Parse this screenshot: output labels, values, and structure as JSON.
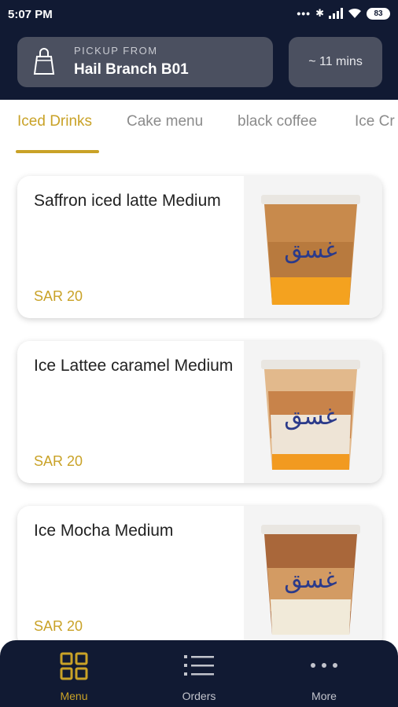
{
  "status_bar": {
    "time": "5:07 PM",
    "battery": "83"
  },
  "pickup": {
    "label": "PICKUP FROM",
    "branch": "Hail Branch B01"
  },
  "eta": "~ 11 mins",
  "tabs": [
    {
      "label": "Iced Drinks",
      "active": true
    },
    {
      "label": "Cake menu"
    },
    {
      "label": "black coffee"
    },
    {
      "label": "Ice Cr"
    }
  ],
  "products": [
    {
      "name": "Saffron iced latte Medium",
      "price": "SAR 20",
      "image_icon": "iced-latte-cup-icon"
    },
    {
      "name": "Ice Lattee caramel Medium",
      "price": "SAR 20",
      "image_icon": "iced-latte-cup-icon"
    },
    {
      "name": "Ice Mocha Medium",
      "price": "SAR 20",
      "image_icon": "iced-mocha-cup-icon"
    }
  ],
  "bottom_nav": [
    {
      "label": "Menu",
      "icon": "grid-icon",
      "active": true
    },
    {
      "label": "Orders",
      "icon": "list-icon"
    },
    {
      "label": "More",
      "icon": "more-icon"
    }
  ],
  "colors": {
    "header_bg": "#111a33",
    "accent": "#c9a227",
    "card_dark": "#4b5060"
  }
}
